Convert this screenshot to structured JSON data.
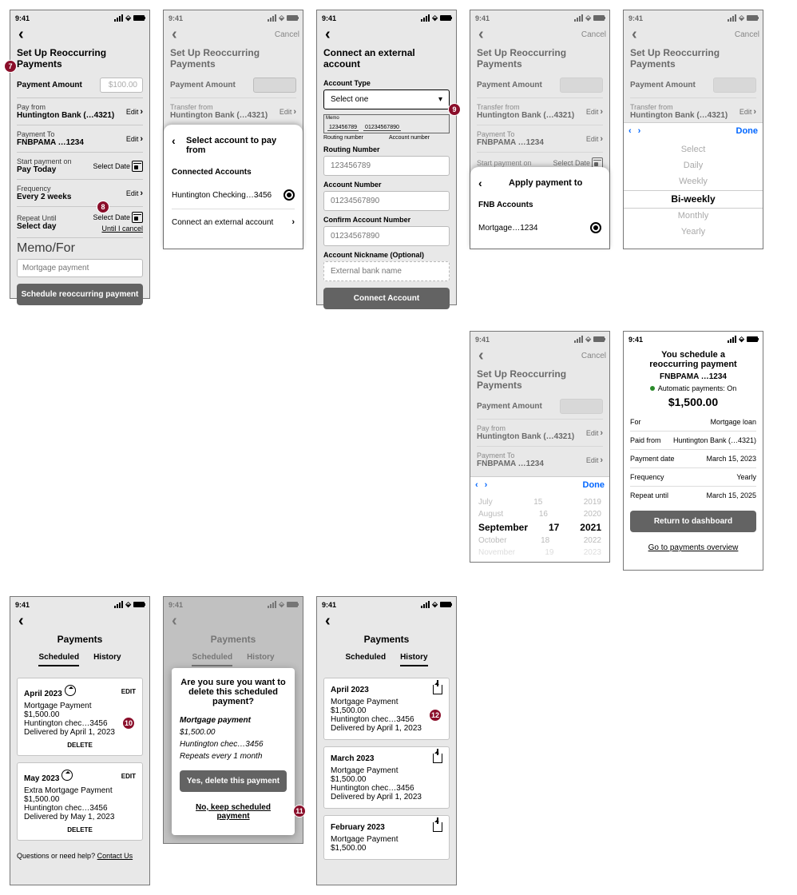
{
  "status": {
    "time": "9:41"
  },
  "setup": {
    "title": "Set Up Reoccurring Payments",
    "amount_label": "Payment Amount",
    "amount_placeholder": "$100.00",
    "pay_from_label": "Pay from",
    "pay_from_value": "Huntington Bank (…4321)",
    "edit": "Edit",
    "payment_to_label": "Payment To",
    "payment_to_value": "FNBPAMA …1234",
    "start_label": "Start payment on",
    "start_value": "Pay Today",
    "select_date": "Select Date",
    "freq_label": "Frequency",
    "freq_value": "Every 2 weeks",
    "repeat_label": "Repeat Until",
    "repeat_value": "Select day",
    "until_cancel": "Until I cancel",
    "memo_label": "Memo/For",
    "memo_placeholder": "Mortgage payment",
    "cta": "Schedule reoccurring payment",
    "cancel": "Cancel",
    "transfer_from_label": "Transfer from"
  },
  "accountSheet": {
    "title": "Select account to pay from",
    "section": "Connected Accounts",
    "option1": "Huntington Checking…3456",
    "external": "Connect an external account"
  },
  "external": {
    "title": "Connect an external account",
    "acct_type": "Account Type",
    "select_one": "Select one",
    "check_rn": "123456789",
    "check_an": "01234567890",
    "rn_label": "Routing number",
    "an_label": "Account number",
    "rn_field": "Routing Number",
    "rn_ph": "123456789",
    "an_field": "Account Number",
    "an_ph": "01234567890",
    "can_field": "Confirm Account Number",
    "can_ph": "01234567890",
    "nick_field": "Account Nickname (Optional)",
    "nick_ph": "External bank name",
    "cta": "Connect Account"
  },
  "applySheet": {
    "title": "Apply payment to",
    "section": "FNB Accounts",
    "option1": "Mortgage…1234"
  },
  "freqPicker": {
    "done": "Done",
    "options": [
      "Select",
      "Daily",
      "Weekly",
      "Bi-weekly",
      "Monthly",
      "Yearly"
    ]
  },
  "datePicker": {
    "done": "Done",
    "rows": [
      {
        "m": "July",
        "d": "15",
        "y": "2019"
      },
      {
        "m": "August",
        "d": "16",
        "y": "2020"
      },
      {
        "m": "September",
        "d": "17",
        "y": "2021"
      },
      {
        "m": "October",
        "d": "18",
        "y": "2022"
      },
      {
        "m": "November",
        "d": "19",
        "y": "2023"
      }
    ]
  },
  "confirm": {
    "title1": "You schedule a",
    "title2": "reoccurring payment",
    "acct": "FNBPAMA …1234",
    "auto": "Automatic payments: On",
    "amount": "$1,500.00",
    "for_l": "For",
    "for_v": "Mortgage loan",
    "from_l": "Paid from",
    "from_v": "Huntington Bank (…4321)",
    "date_l": "Payment date",
    "date_v": "March 15, 2023",
    "freq_l": "Frequency",
    "freq_v": "Yearly",
    "rep_l": "Repeat until",
    "rep_v": "March 15, 2025",
    "cta": "Return to dashboard",
    "link": "Go to payments overview"
  },
  "payments": {
    "title": "Payments",
    "tab_sched": "Scheduled",
    "tab_hist": "History",
    "edit": "EDIT",
    "delete": "DELETE",
    "q": "Questions or need help?",
    "contact": "Contact Us",
    "card1": {
      "head": "April 2023",
      "name": "Mortgage Payment",
      "amt": "$1,500.00",
      "from": "Huntington chec…3456",
      "deliv": "Delivered by April 1, 2023"
    },
    "card2": {
      "head": "May 2023",
      "name": "Extra Mortgage Payment",
      "amt": "$1,500.00",
      "from": "Huntington chec…3456",
      "deliv": "Delivered by May 1, 2023"
    }
  },
  "deleteModal": {
    "q": "Are you sure you want to delete this scheduled payment?",
    "name": "Mortgage payment",
    "amt": "$1,500.00",
    "from": "Huntington chec…3456",
    "rep": "Repeats every 1 month",
    "yes": "Yes, delete this payment",
    "no": "No, keep scheduled payment"
  },
  "history": {
    "c1": {
      "head": "April 2023",
      "name": "Mortgage Payment",
      "amt": "$1,500.00",
      "from": "Huntington chec…3456",
      "deliv": "Delivered by April 1, 2023"
    },
    "c2": {
      "head": "March 2023",
      "name": "Mortgage Payment",
      "amt": "$1,500.00",
      "from": "Huntington chec…3456",
      "deliv": "Delivered by April 1, 2023"
    },
    "c3": {
      "head": "February 2023",
      "name": "Mortgage Payment",
      "amt": "$1,500.00"
    }
  },
  "badges": {
    "b7": "7",
    "b8": "8",
    "b9": "9",
    "b10": "10",
    "b11": "11",
    "b12": "12"
  }
}
